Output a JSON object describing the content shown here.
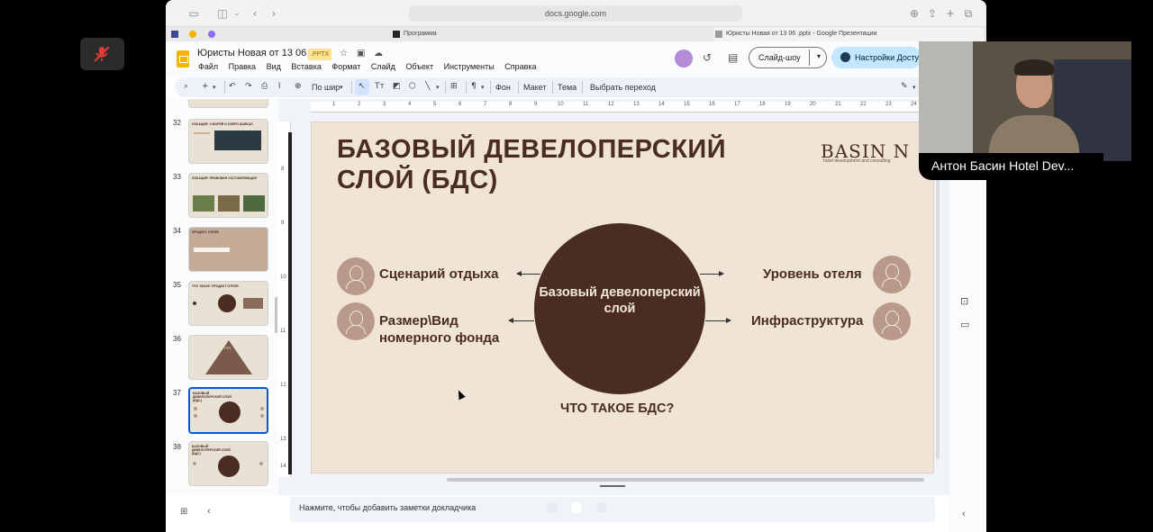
{
  "browser": {
    "url": "docs.google.com",
    "tabs": [
      {
        "label": "Программа"
      },
      {
        "label": "Юристы Новая от 13 06 .pptx - Google Презентации"
      }
    ]
  },
  "docs": {
    "title": "Юристы Новая от 13 06",
    "extension": ".PPTX",
    "menu": [
      "Файл",
      "Правка",
      "Вид",
      "Вставка",
      "Формат",
      "Слайд",
      "Объект",
      "Инструменты",
      "Справка"
    ],
    "slideshow_label": "Слайд-шоу",
    "share_label": "Настройки Досту"
  },
  "toolbar": {
    "zoom_label": "По шир",
    "background_label": "Фон",
    "layout_label": "Макет",
    "theme_label": "Тема",
    "transition_label": "Выбрать переход"
  },
  "filmstrip": {
    "slides": [
      {
        "num": "32",
        "title": "ЛОКАЦИЯ: 3 МОРЕЙ И ОЗЕРО БАЙКАЛ"
      },
      {
        "num": "33",
        "title": "ЛОКАЦИЯ: ПРАВОВАЯ СОСТАВЛЯЮЩАЯ"
      },
      {
        "num": "34",
        "title": "ПРОДУКТ ОТЕЛЯ"
      },
      {
        "num": "35",
        "title": "ЧТО ТАКОЕ: ПРОДУКТ ОТЕЛЯ"
      },
      {
        "num": "36",
        "title": "УТП"
      },
      {
        "num": "37",
        "title": "БАЗОВЫЙ ДЕВЕЛОПЕРСКИЙ СЛОЙ (БДС)"
      },
      {
        "num": "38",
        "title": "БАЗОВЫЙ ДЕВЕЛОПЕРСКИЙ СЛОЙ (БДС)"
      }
    ],
    "selected_index": 5
  },
  "ruler": {
    "top": [
      "1",
      "2",
      "3",
      "4",
      "5",
      "6",
      "7",
      "8",
      "9",
      "10",
      "11",
      "12",
      "13",
      "14",
      "15",
      "16",
      "17",
      "18",
      "19",
      "20",
      "21",
      "22",
      "23",
      "24"
    ],
    "left": [
      "8",
      "9",
      "10",
      "11",
      "12",
      "13",
      "14"
    ]
  },
  "slide": {
    "title": "БАЗОВЫЙ ДЕВЕЛОПЕРСКИЙ СЛОЙ (БДС)",
    "brand": "BASIN N",
    "brand_sub": "hotel development and consulting",
    "center": "Базовый девелоперский слой",
    "left_items": [
      "Сценарий отдыха",
      "Размер\\Вид номерного фонда"
    ],
    "right_items": [
      "Уровень отеля",
      "Инфраструктура"
    ],
    "question": "ЧТО ТАКОЕ БДС?"
  },
  "notes": {
    "placeholder": "Нажмите, чтобы добавить заметки докладчика"
  },
  "video": {
    "participant_name": "Антон Басин Hotel Dev..."
  },
  "colors": {
    "slide_bg": "#efe4d5",
    "slide_dark": "#4a2c22",
    "accent_person": "#b8998a",
    "share_btn": "#c2e7ff",
    "selection": "#0b57d0"
  }
}
